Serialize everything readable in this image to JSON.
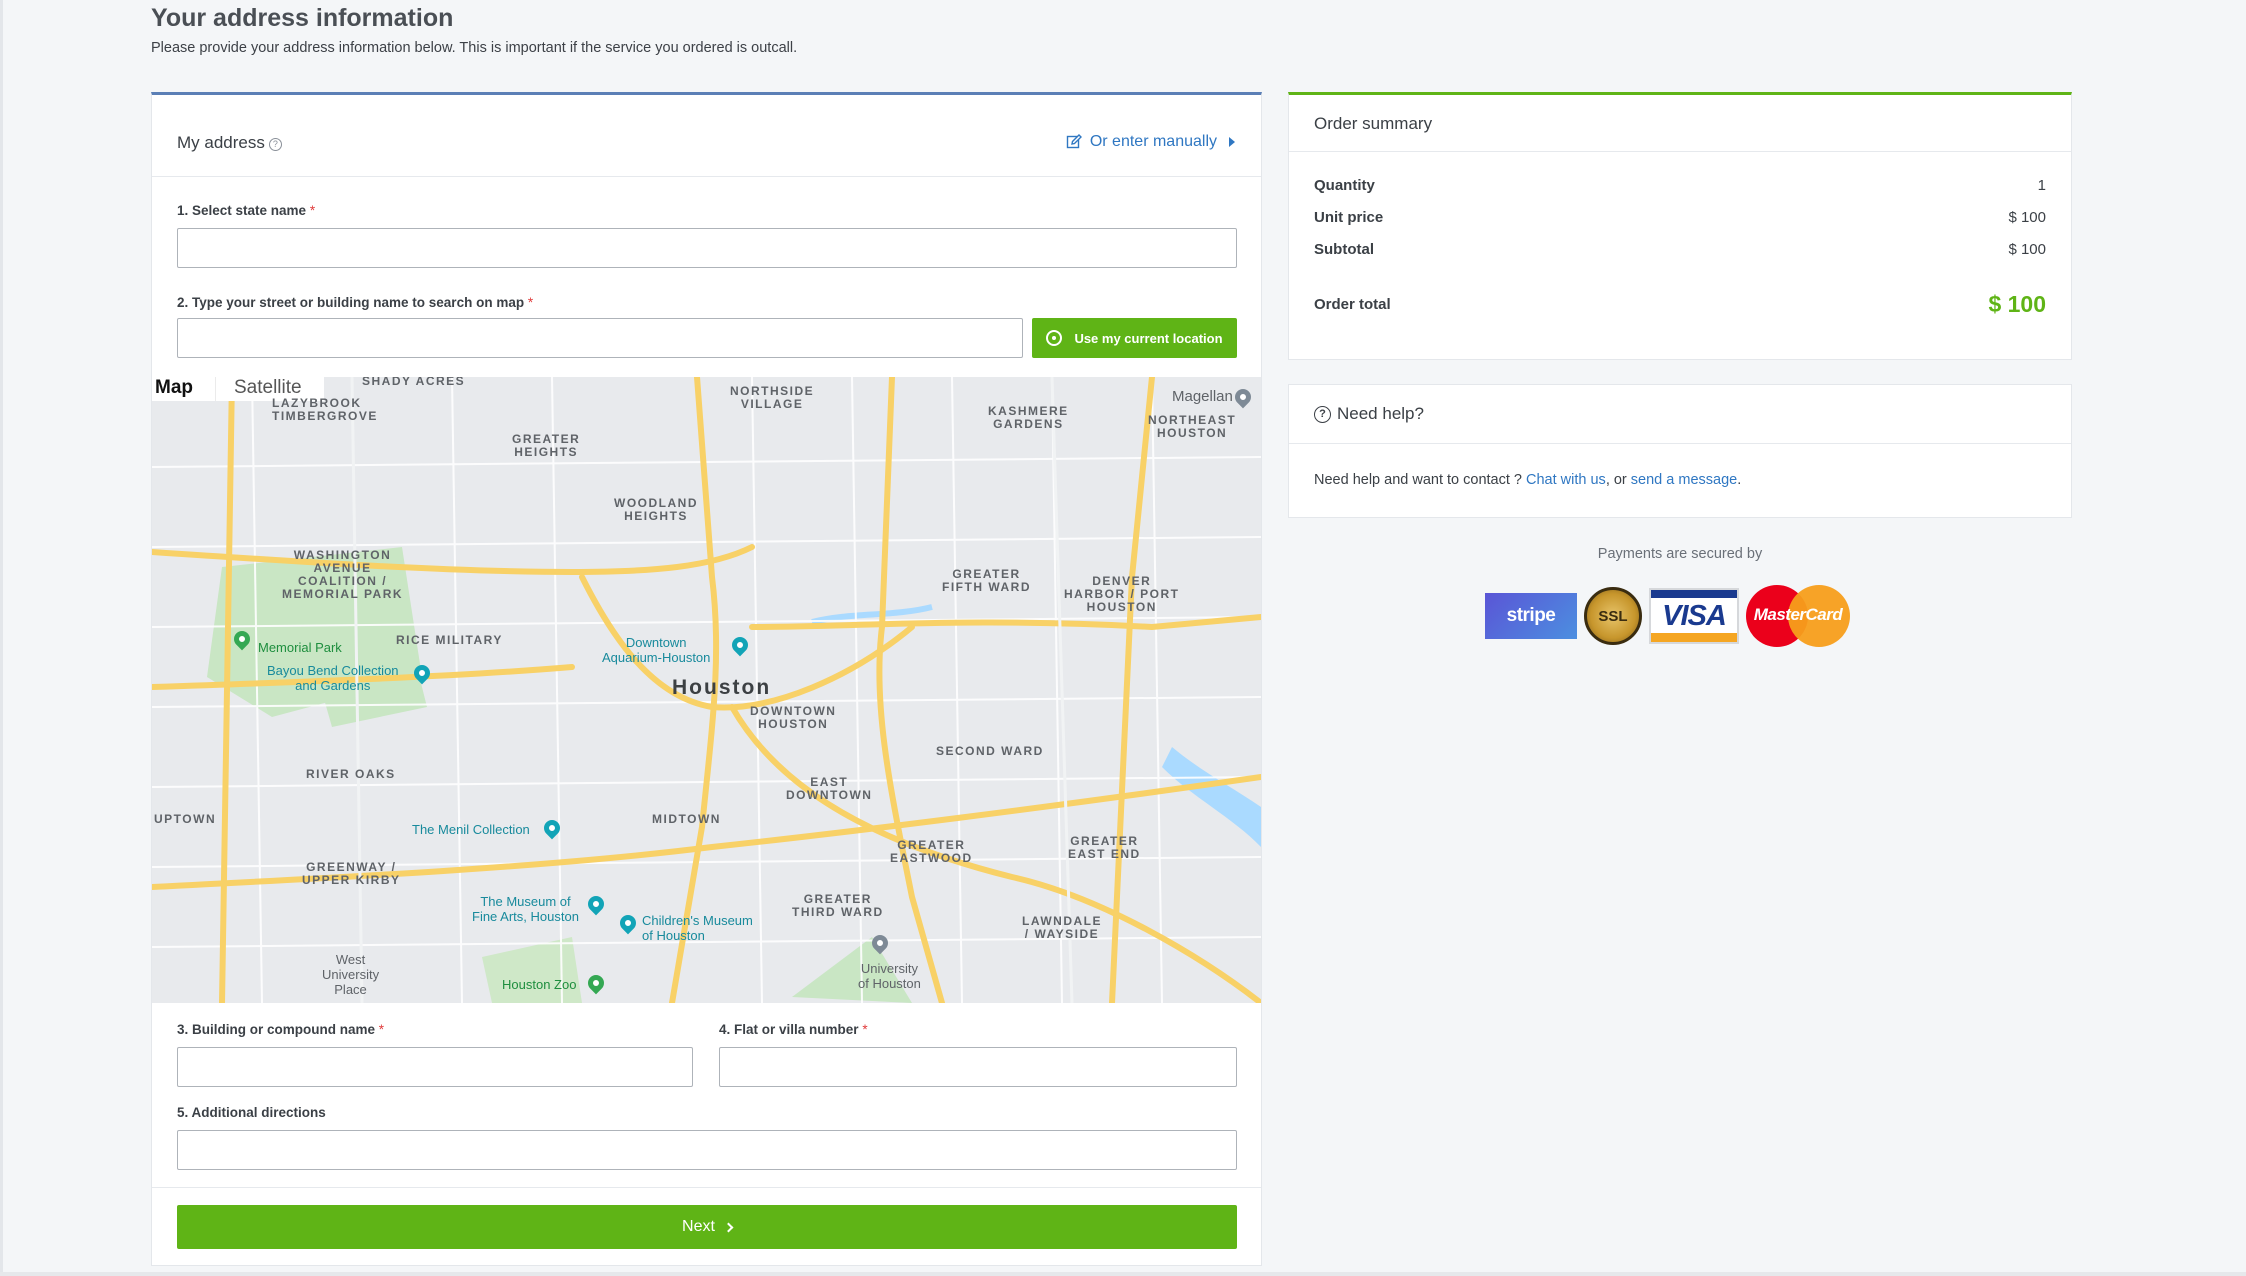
{
  "page": {
    "title": "Your address information",
    "subtitle": "Please provide your address information below. This is important if the service you ordered is outcall."
  },
  "address_card": {
    "title": "My address",
    "help_glyph": "?",
    "enter_manually": "Or enter manually",
    "fields": {
      "state": {
        "label": "1. Select state name",
        "required": "*",
        "value": ""
      },
      "street": {
        "label": "2. Type your street or building name to search on map",
        "required": "*",
        "value": ""
      },
      "building": {
        "label": "3. Building or compound name",
        "required": "*",
        "value": ""
      },
      "flat": {
        "label": "4. Flat or villa number",
        "required": "*",
        "value": ""
      },
      "directions": {
        "label": "5. Additional directions",
        "value": ""
      }
    },
    "use_location": "Use my current location",
    "next": "Next"
  },
  "map": {
    "tabs": [
      "Map",
      "Satellite"
    ],
    "city": "Houston",
    "labels": {
      "timbergrove": "TIMBERGROVE",
      "lazybrook": "LAZYBROOK",
      "shady_acres": "SHADY ACRES",
      "northside": "NORTHSIDE\nVILLAGE",
      "kashmere": "KASHMERE\nGARDENS",
      "magellan": "Magellan",
      "northeast": "NORTHEAST\nHOUSTON",
      "greater_heights": "GREATER\nHEIGHTS",
      "woodland": "WOODLAND\nHEIGHTS",
      "washington": "WASHINGTON\nAVENUE\nCOALITION /\nMEMORIAL PARK",
      "fifth_ward": "GREATER\nFIFTH WARD",
      "denver": "DENVER\nHARBOR / PORT\nHOUSTON",
      "rice_military": "RICE MILITARY",
      "downtown": "DOWNTOWN\nHOUSTON",
      "second_ward": "SECOND WARD",
      "east_downtown": "EAST\nDOWNTOWN",
      "river_oaks": "RIVER OAKS",
      "uptown": "UPTOWN",
      "midtown": "MIDTOWN",
      "greenway": "GREENWAY /\nUPPER KIRBY",
      "greater_eastwood": "GREATER\nEASTWOOD",
      "greater_east_end": "GREATER\nEAST END",
      "third_ward": "GREATER\nTHIRD WARD",
      "lawndale": "LAWNDALE\n/ WAYSIDE",
      "west_university": "West\nUniversity\nPlace"
    },
    "pois": {
      "memorial_park": "Memorial Park",
      "bayou_bend": "Bayou Bend Collection\nand Gardens",
      "aquarium": "Downtown\nAquarium-Houston",
      "menil": "The Menil Collection",
      "mfa": "The Museum of\nFine Arts, Houston",
      "childrens": "Children's Museum\nof Houston",
      "zoo": "Houston Zoo",
      "uh": "University\nof Houston"
    }
  },
  "order_summary": {
    "title": "Order summary",
    "rows": [
      {
        "label": "Quantity",
        "value": "1"
      },
      {
        "label": "Unit price",
        "value": "$ 100"
      },
      {
        "label": "Subtotal",
        "value": "$ 100"
      }
    ],
    "total_label": "Order total",
    "total_value": "$ 100"
  },
  "help": {
    "title": "Need help?",
    "text_prefix": "Need help and want to contact ? ",
    "chat_link": "Chat with us",
    "middle": ", or ",
    "message_link": "send a message",
    "suffix": "."
  },
  "payments": {
    "secured_text": "Payments are secured by",
    "stripe": "stripe",
    "ssl": "SSL",
    "visa": "VISA",
    "mastercard": "MasterCard"
  },
  "colors": {
    "accent_green": "#5fb416",
    "link_blue": "#2f77c2",
    "card_top_blue": "#5b7fb6"
  }
}
